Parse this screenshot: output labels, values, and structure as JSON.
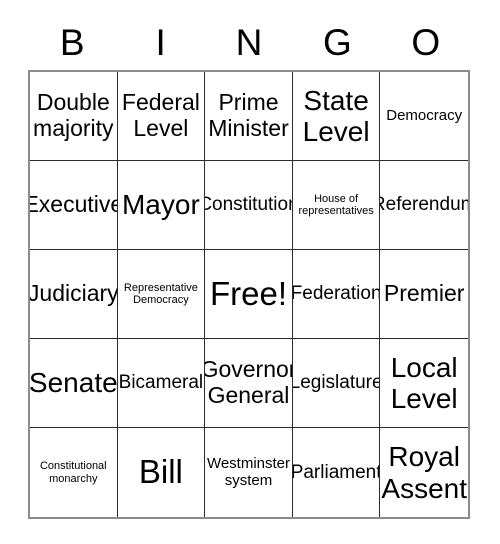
{
  "card": {
    "header_letters": [
      "B",
      "I",
      "N",
      "G",
      "O"
    ],
    "columns": 5,
    "rows": 5,
    "free_space_label": "Free!",
    "border_color": "#2b2b2b",
    "outer_border_color": "#8c8c8c",
    "background_color": "#ffffff",
    "text_color": "#000000",
    "cells": [
      {
        "text": "Double\nmajority",
        "size": "lg"
      },
      {
        "text": "Federal\nLevel",
        "size": "lg"
      },
      {
        "text": "Prime\nMinister",
        "size": "lg"
      },
      {
        "text": "State\nLevel",
        "size": "xl"
      },
      {
        "text": "Democracy",
        "size": "sm"
      },
      {
        "text": "Executive",
        "size": "lg"
      },
      {
        "text": "Mayor",
        "size": "xl"
      },
      {
        "text": "Constitution",
        "size": "md"
      },
      {
        "text": "House of\nrepresentatives",
        "size": "xs"
      },
      {
        "text": "Referendum",
        "size": "md"
      },
      {
        "text": "Judiciary",
        "size": "lg"
      },
      {
        "text": "Representative\nDemocracy",
        "size": "xs"
      },
      {
        "text": "Free!",
        "size": "xxl"
      },
      {
        "text": "Federation",
        "size": "md"
      },
      {
        "text": "Premier",
        "size": "lg"
      },
      {
        "text": "Senate",
        "size": "xl"
      },
      {
        "text": "Bicameral",
        "size": "md"
      },
      {
        "text": "Governor\nGeneral",
        "size": "lg"
      },
      {
        "text": "Legislature",
        "size": "md"
      },
      {
        "text": "Local\nLevel",
        "size": "xl"
      },
      {
        "text": "Constitutional\nmonarchy",
        "size": "xs"
      },
      {
        "text": "Bill",
        "size": "xxl"
      },
      {
        "text": "Westminster\nsystem",
        "size": "sm"
      },
      {
        "text": "Parliament",
        "size": "md"
      },
      {
        "text": "Royal\nAssent",
        "size": "xl"
      }
    ]
  }
}
